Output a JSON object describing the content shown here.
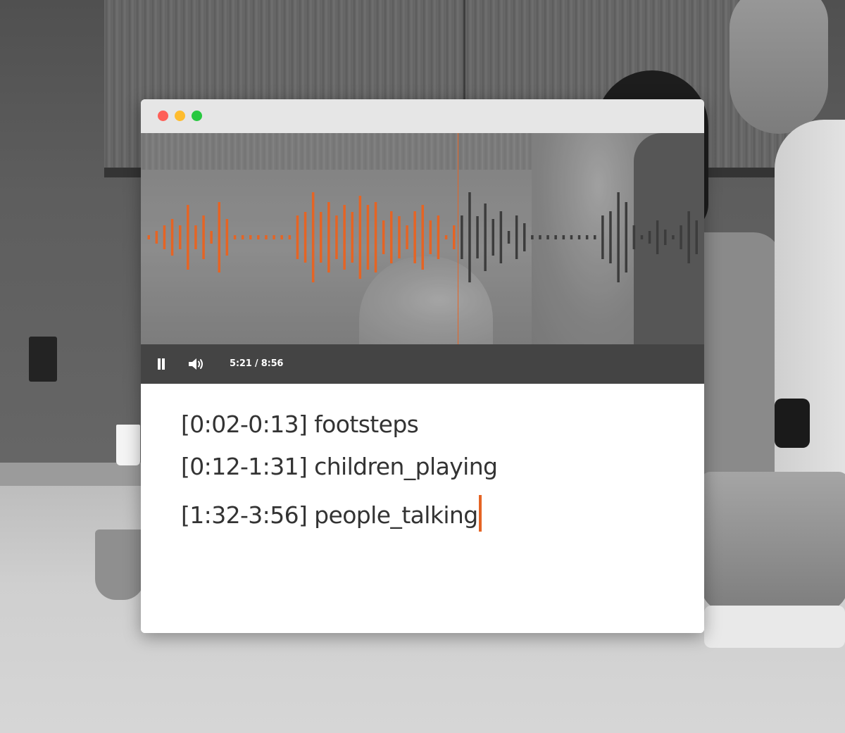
{
  "window": {
    "traffic_lights": [
      "#fe5f57",
      "#febc2e",
      "#28c840"
    ]
  },
  "player": {
    "current_time": "5:21",
    "duration": "8:56",
    "time_display": "5:21 / 8:56",
    "progress_fraction": 0.56,
    "played_color": "#e56424",
    "unplayed_color": "#3c3c3c",
    "pause_icon": "pause-icon",
    "volume_icon": "volume-icon"
  },
  "transcript": {
    "lines": [
      "[0:02-0:13] footsteps",
      "[0:12-1:31] children_playing",
      "[1:32-3:56] people_talking"
    ],
    "caret_color": "#e56424"
  }
}
